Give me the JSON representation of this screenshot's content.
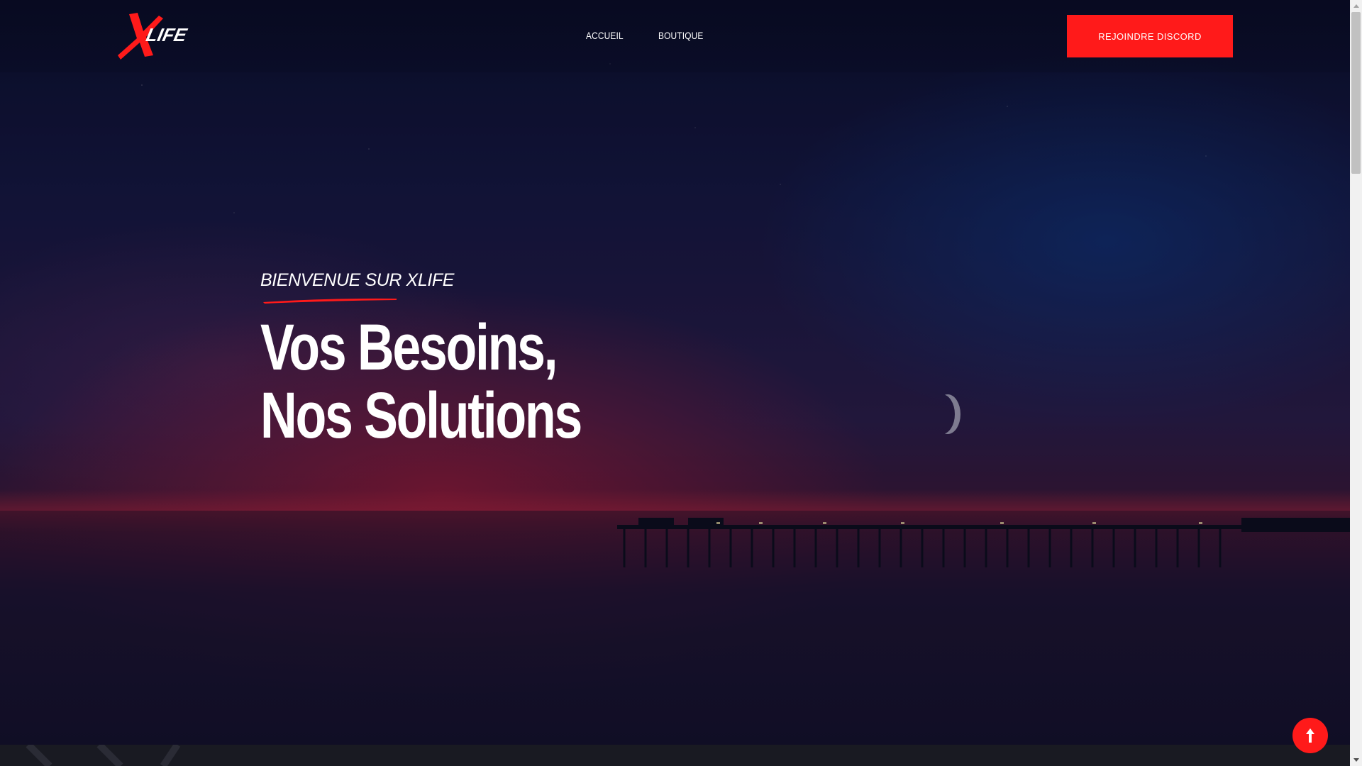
{
  "brand": {
    "logo_mark": "X",
    "logo_text": "LIFE",
    "accent_color": "#ff1a1a"
  },
  "nav": {
    "items": [
      {
        "label": "ACCUEIL"
      },
      {
        "label": "BOUTIQUE"
      }
    ]
  },
  "header": {
    "cta_label": "REJOINDRE DISCORD"
  },
  "hero": {
    "subtitle": "BIENVENUE SUR XLIFE",
    "headline_line1": "Vos Besoins,",
    "headline_line2": "Nos Solutions"
  },
  "controls": {
    "scroll_top_icon": "arrow-up-icon"
  }
}
